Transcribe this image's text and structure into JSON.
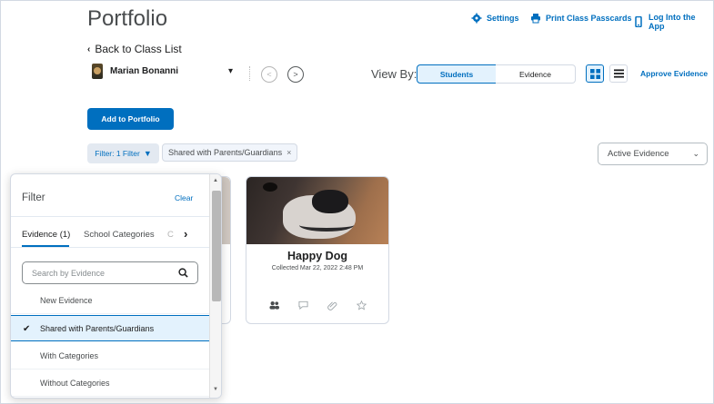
{
  "header": {
    "title": "Portfolio",
    "settings": "Settings",
    "print_passcards": "Print Class Passcards",
    "log_into_app": "Log Into the App"
  },
  "back_link": "Back to Class List",
  "student": {
    "name": "Marian Bonanni"
  },
  "view_by": {
    "label": "View By:",
    "students": "Students",
    "evidence": "Evidence"
  },
  "approve_evidence": "Approve Evidence",
  "add_button": "Add to Portfolio",
  "filter": {
    "button": "Filter: 1 Filter",
    "chip": "Shared with Parents/Guardians",
    "chip_close": "×"
  },
  "active_select": {
    "value": "Active Evidence"
  },
  "card": {
    "title": "Happy Dog",
    "subtitle": "Collected Mar 22, 2022 2:48 PM"
  },
  "dropdown": {
    "title": "Filter",
    "clear": "Clear",
    "tabs": [
      "Evidence (1)",
      "School Categories",
      "C"
    ],
    "search_placeholder": "Search by Evidence",
    "items": [
      "New Evidence",
      "Shared with Parents/Guardians",
      "With Categories",
      "Without Categories"
    ],
    "selected_index": 1
  },
  "colors": {
    "accent": "#006fbf",
    "selected_bg": "#e3f2fd"
  }
}
